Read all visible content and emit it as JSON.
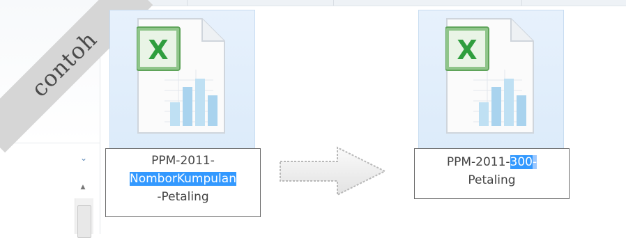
{
  "watermark": {
    "text": "contoh"
  },
  "left_pane": {
    "chevron_icon": "chevron-down-icon",
    "scroll_up_icon": "scroll-up-icon"
  },
  "files": [
    {
      "icon": "excel-file-icon",
      "rename": {
        "line1": "PPM-2011-",
        "line2_selected": "NomborKumpulan",
        "line3": "-Petaling"
      }
    },
    {
      "icon": "excel-file-icon",
      "rename": {
        "prefix": "PPM-2011-",
        "selected": "300",
        "suffix": "-",
        "line2": "Petaling"
      }
    }
  ],
  "arrow_icon": "right-arrow-icon",
  "colors": {
    "selection": "#3399ff",
    "tile": "#dcebfa",
    "excel_green": "#2f9e3e"
  }
}
